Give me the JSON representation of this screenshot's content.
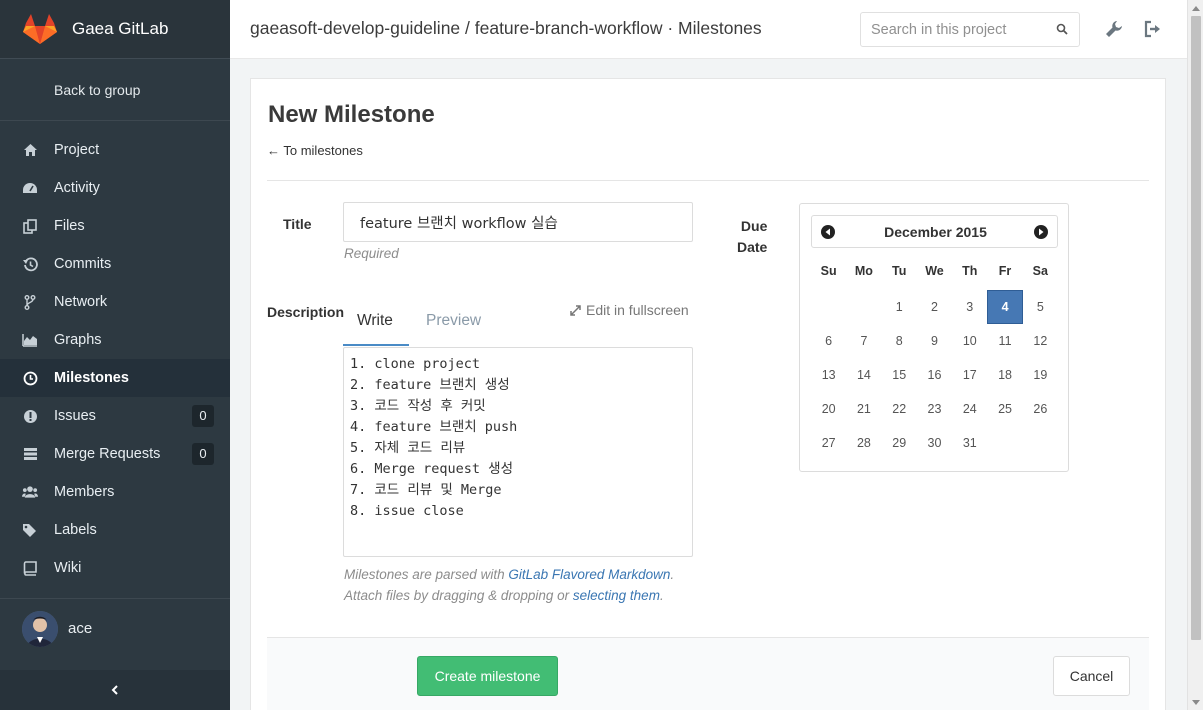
{
  "brand": {
    "name": "Gaea GitLab"
  },
  "sidebar": {
    "back_label": "Back to group",
    "items": [
      {
        "label": "Project",
        "icon": "home-icon",
        "active": false
      },
      {
        "label": "Activity",
        "icon": "dashboard-icon",
        "active": false
      },
      {
        "label": "Files",
        "icon": "files-icon",
        "active": false
      },
      {
        "label": "Commits",
        "icon": "history-icon",
        "active": false
      },
      {
        "label": "Network",
        "icon": "code-fork-icon",
        "active": false
      },
      {
        "label": "Graphs",
        "icon": "area-chart-icon",
        "active": false
      },
      {
        "label": "Milestones",
        "icon": "clock-icon",
        "active": true
      },
      {
        "label": "Issues",
        "icon": "exclamation-circle-icon",
        "active": false,
        "badge": "0"
      },
      {
        "label": "Merge Requests",
        "icon": "tasks-icon",
        "active": false,
        "badge": "0"
      },
      {
        "label": "Members",
        "icon": "users-icon",
        "active": false
      },
      {
        "label": "Labels",
        "icon": "tags-icon",
        "active": false
      },
      {
        "label": "Wiki",
        "icon": "book-icon",
        "active": false
      }
    ],
    "user": {
      "name": "ace"
    },
    "collapse_glyph": "‹"
  },
  "header": {
    "breadcrumb": "gaeasoft-develop-guideline / feature-branch-workflow · Milestones",
    "search_placeholder": "Search in this project"
  },
  "page": {
    "title": "New Milestone",
    "back_link": "← To milestones"
  },
  "form": {
    "title_label": "Title",
    "title_value": "feature 브랜치 workflow 실습",
    "required_hint": "Required",
    "description_label": "Description",
    "tab_write": "Write",
    "tab_preview": "Preview",
    "fullscreen_label": "Edit in fullscreen",
    "description_value": "1. clone project\n2. feature 브랜치 생성\n3. 코드 작성 후 커밋\n4. feature 브랜치 push\n5. 자체 코드 리뷰\n6. Merge request 생성\n7. 코드 리뷰 및 Merge\n8. issue close",
    "md_hint_prefix": "Milestones are parsed with ",
    "md_hint_link": "GitLab Flavored Markdown",
    "md_hint_suffix": ".",
    "attach_prefix": "Attach files by dragging & dropping or ",
    "attach_link": "selecting them",
    "attach_suffix": ".",
    "due_label_1": "Due",
    "due_label_2": "Date"
  },
  "datepicker": {
    "month_title": "December 2015",
    "weekdays": [
      "Su",
      "Mo",
      "Tu",
      "We",
      "Th",
      "Fr",
      "Sa"
    ],
    "weeks": [
      [
        "",
        "",
        "1",
        "2",
        "3",
        "4",
        "5"
      ],
      [
        "6",
        "7",
        "8",
        "9",
        "10",
        "11",
        "12"
      ],
      [
        "13",
        "14",
        "15",
        "16",
        "17",
        "18",
        "19"
      ],
      [
        "20",
        "21",
        "22",
        "23",
        "24",
        "25",
        "26"
      ],
      [
        "27",
        "28",
        "29",
        "30",
        "31",
        "",
        ""
      ]
    ],
    "selected_day": "4"
  },
  "actions": {
    "create_label": "Create milestone",
    "cancel_label": "Cancel"
  },
  "colors": {
    "sidebar_bg": "#2d3941",
    "accent_blue": "#4678b4",
    "create_green": "#42bd74",
    "link_blue": "#3a76b2"
  }
}
